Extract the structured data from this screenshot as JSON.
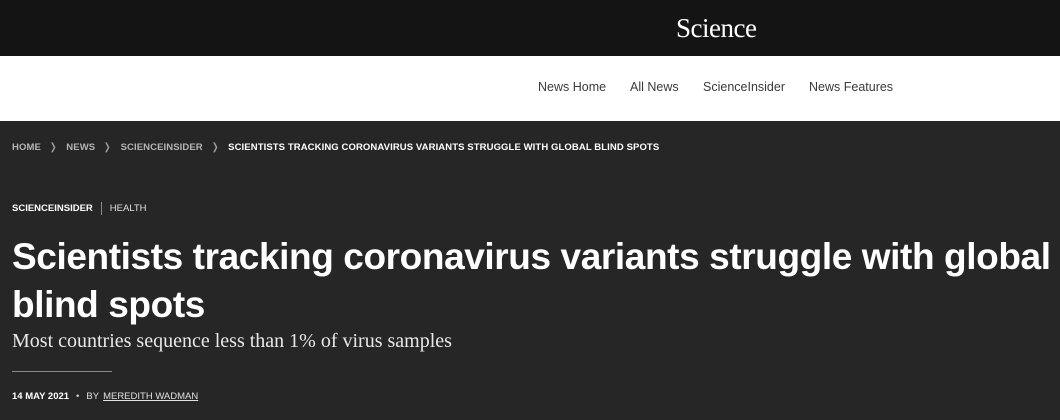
{
  "header": {
    "logo": "Science"
  },
  "nav": {
    "items": [
      {
        "label": "News Home"
      },
      {
        "label": "All News"
      },
      {
        "label": "ScienceInsider"
      },
      {
        "label": "News Features"
      }
    ]
  },
  "breadcrumb": {
    "items": [
      {
        "label": "HOME"
      },
      {
        "label": "NEWS"
      },
      {
        "label": "SCIENCEINSIDER"
      },
      {
        "label": "SCIENTISTS TRACKING CORONAVIRUS VARIANTS STRUGGLE WITH GLOBAL BLIND SPOTS"
      }
    ]
  },
  "article": {
    "section": "SCIENCEINSIDER",
    "topic": "HEALTH",
    "title": "Scientists tracking coronavirus variants struggle with global blind spots",
    "dek": "Most countries sequence less than 1% of virus samples",
    "date": "14 MAY 2021",
    "by": "BY",
    "author": "MEREDITH WADMAN"
  }
}
